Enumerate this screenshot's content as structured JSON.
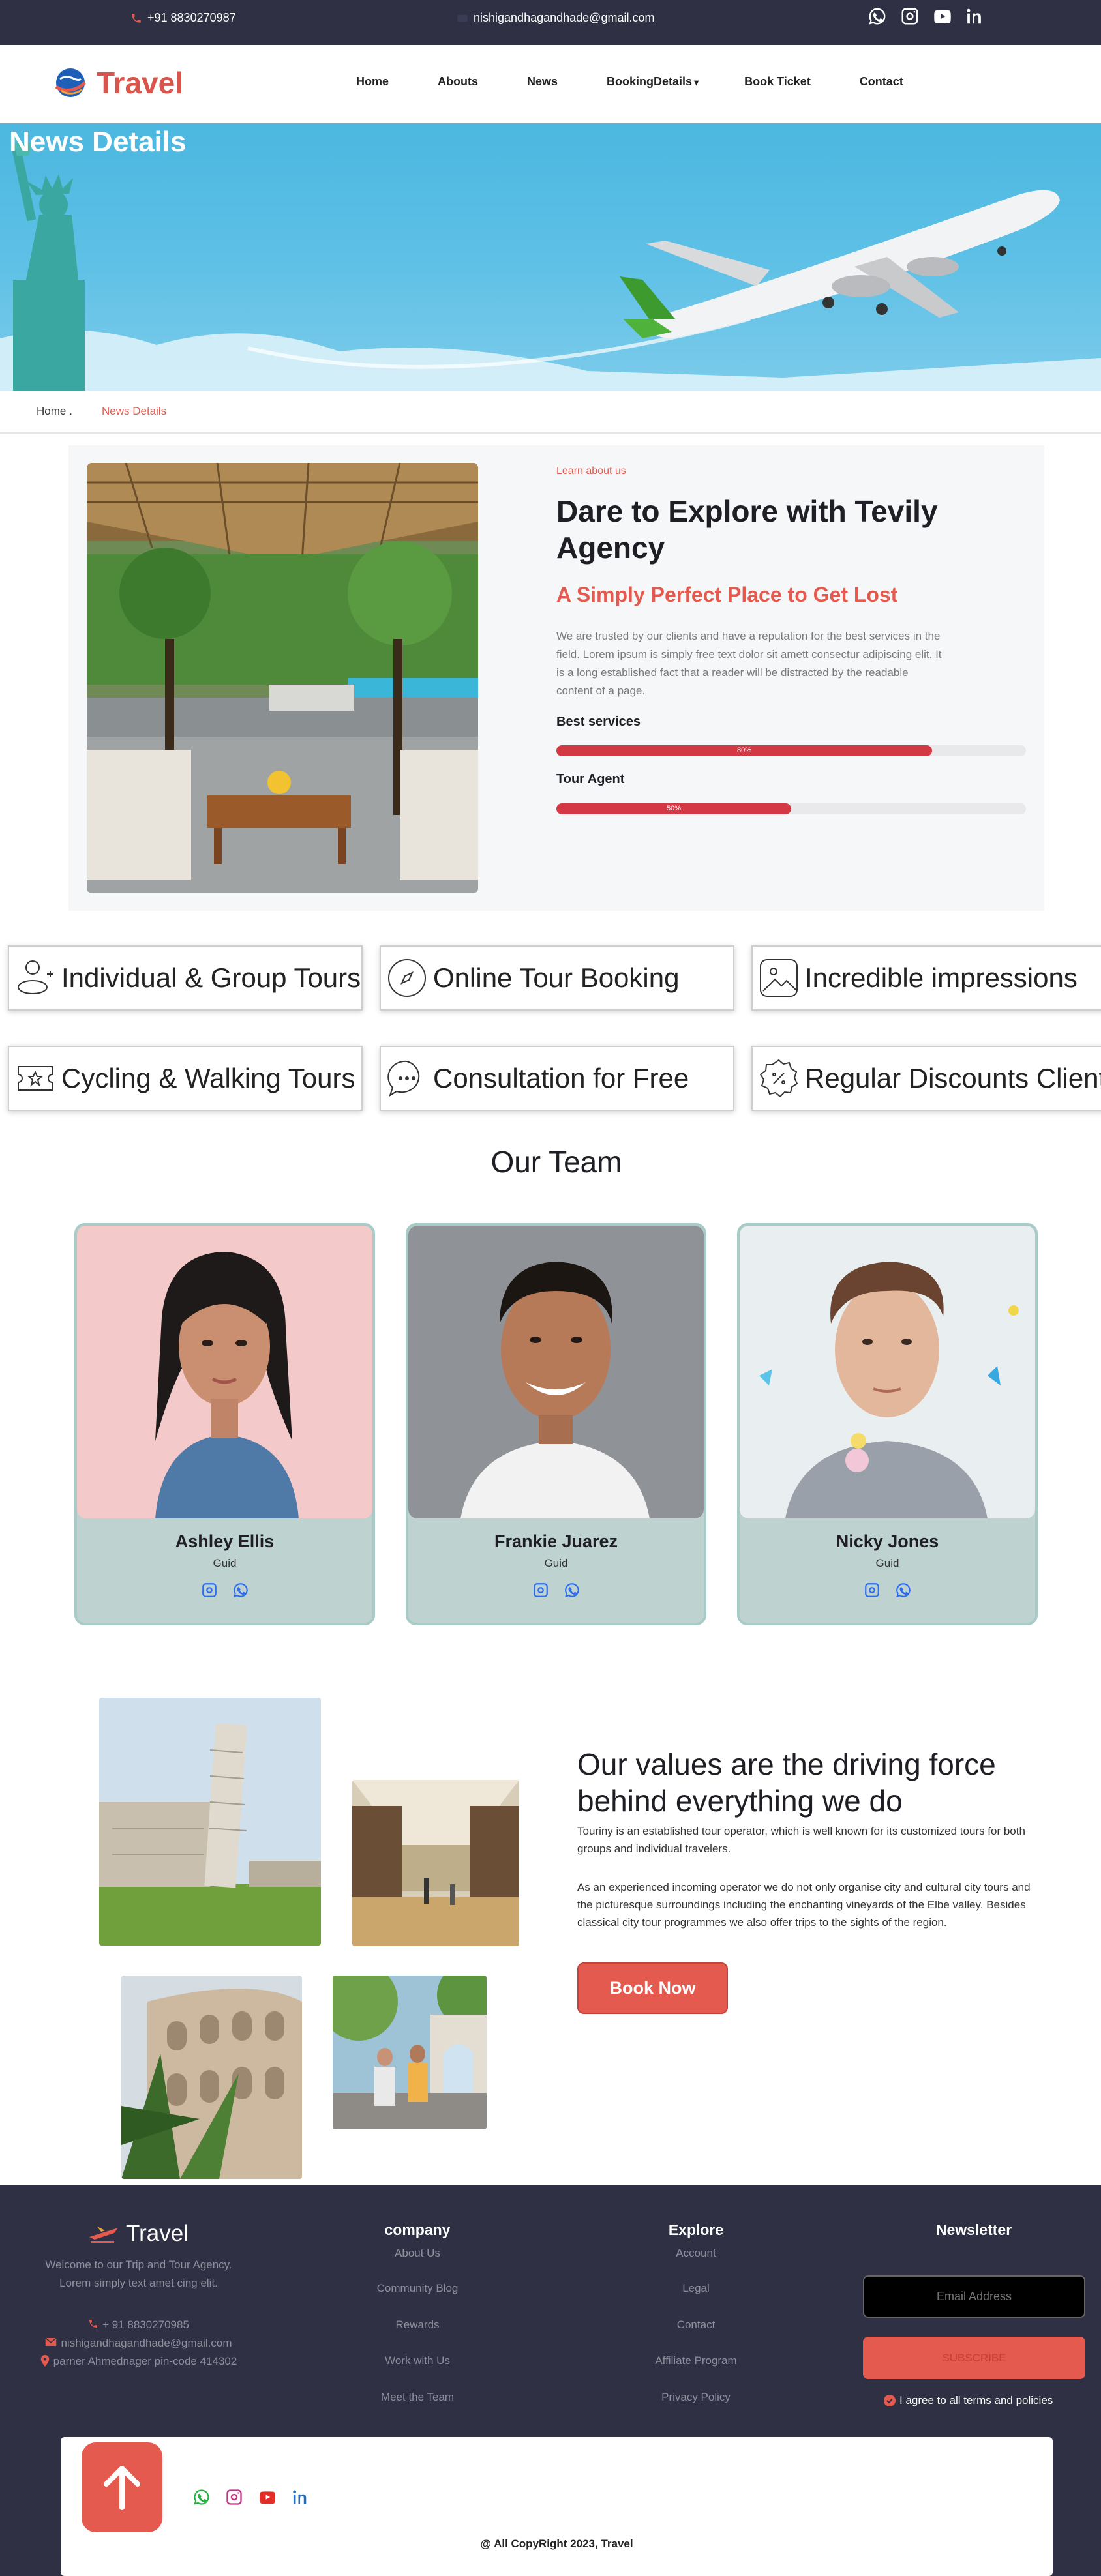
{
  "topbar": {
    "phone": "+91 8830270987",
    "email": "nishigandhagandhade@gmail.com",
    "social_icons": [
      "whatsapp-icon",
      "instagram-icon",
      "youtube-icon",
      "linkedin-icon"
    ]
  },
  "nav": {
    "brand": "Travel",
    "items": [
      {
        "label": "Home"
      },
      {
        "label": "Abouts"
      },
      {
        "label": "News"
      },
      {
        "label": "BookingDetails"
      },
      {
        "label": "Book Ticket"
      },
      {
        "label": "Contact"
      }
    ]
  },
  "hero": {
    "title": "News Details"
  },
  "breadcrumb": {
    "home": "Home .",
    "current": "News Details"
  },
  "about": {
    "tag": "Learn about us",
    "heading": "Dare to Explore with Tevily Agency",
    "subheading": "A Simply Perfect Place to Get Lost",
    "paragraph": "We are trusted by our clients and have a reputation for the best services in the field. Lorem ipsum is simply free text dolor sit amett consectur adipiscing elit. It is a long established fact that a reader will be distracted by the readable content of a page.",
    "skills": [
      {
        "label": "Best services",
        "percent_label": "80%",
        "value": 0.8
      },
      {
        "label": "Tour Agent",
        "percent_label": "50%",
        "value": 0.5
      }
    ]
  },
  "features": [
    {
      "label": "Individual & Group Tours",
      "icon": "user-plus-icon"
    },
    {
      "label": "Online Tour Booking",
      "icon": "compass-icon"
    },
    {
      "label": "Incredible impressions",
      "icon": "image-icon"
    },
    {
      "label": "Cycling & Walking Tours",
      "icon": "ticket-icon"
    },
    {
      "label": "Consultation for Free",
      "icon": "chat-icon"
    },
    {
      "label": "Regular Discounts Clients",
      "icon": "discount-badge-icon"
    }
  ],
  "team": {
    "title": "Our Team",
    "members": [
      {
        "name": "Ashley Ellis",
        "role": "Guid"
      },
      {
        "name": "Frankie Juarez",
        "role": "Guid"
      },
      {
        "name": "Nicky Jones",
        "role": "Guid"
      }
    ]
  },
  "values": {
    "heading": "Our values are the driving force behind everything we do",
    "p1": "Touriny is an established tour operator, which is well known for its customized tours for both groups and individual travelers.",
    "p2": "As an experienced incoming operator we do not only organise city and cultural city tours and the picturesque surroundings including the enchanting vineyards of the Elbe valley. Besides classical city tour programmes we also offer trips to the sights of the region.",
    "button": "Book Now"
  },
  "footer": {
    "brand": "Travel",
    "about": "Welcome to our Trip and Tour Agency. Lorem simply text amet cing elit.",
    "phone": "+ 91 8830270985",
    "email": "nishigandhagandhade@gmail.com",
    "address": "parner Ahmednager pin-code 414302",
    "company_title": "company",
    "company_links": [
      "About Us",
      "Community Blog",
      "Rewards",
      "Work with Us",
      "Meet the Team"
    ],
    "explore_title": "Explore",
    "explore_links": [
      "Account",
      "Legal",
      "Contact",
      "Affiliate Program",
      "Privacy Policy"
    ],
    "newsletter_title": "Newsletter",
    "email_placeholder": "Email Address",
    "subscribe": "SUBSCRIBE",
    "agree": "I agree to all terms and policies",
    "copyright": "@ All CopyRight 2023, Travel"
  },
  "colors": {
    "accent": "#e55a4e",
    "dark": "#2f3043",
    "team_card": "#bed3d0",
    "progress": "#d53845"
  }
}
